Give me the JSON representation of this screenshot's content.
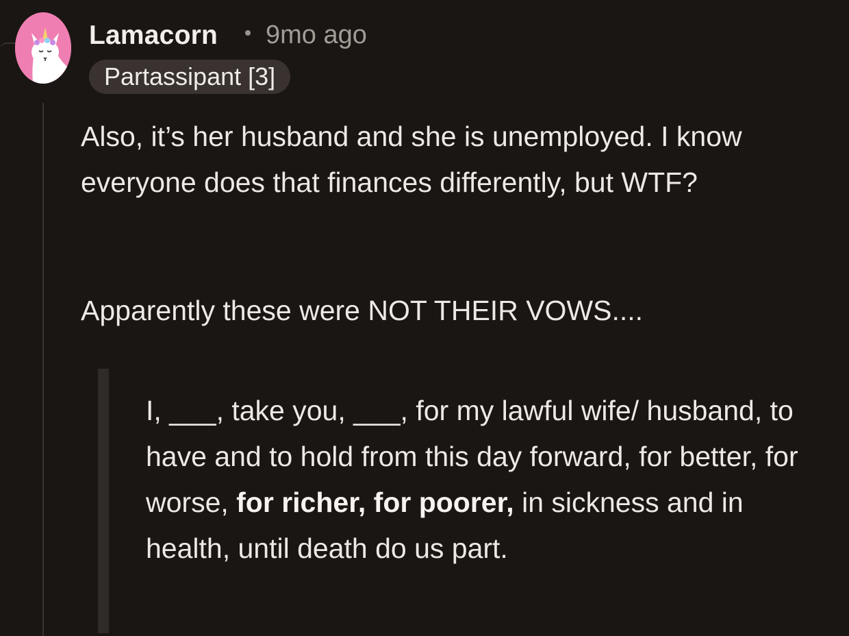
{
  "comment": {
    "author": "Lamacorn",
    "separator": "•",
    "timestamp": "9mo ago",
    "flair": "Partassipant [3]",
    "avatar_icon": "llama-unicorn-avatar-icon",
    "avatar_bg": "#ef7fb2",
    "paragraphs": [
      "Also, it’s her husband and she is unemployed. I know everyone does that finances differently, but WTF?",
      "Apparently these were NOT THEIR VOWS...."
    ],
    "quote": {
      "before": "I, ___, take you, ___, for my lawful wife/ husband, to have and to hold from this day forward, for better, for worse, ",
      "bold": "for richer, for poorer,",
      "after": " in sickness and in health, until death do us part."
    }
  },
  "colors": {
    "background": "#1a1613",
    "text": "#ece9e6",
    "muted": "#a29c97",
    "flair_bg": "#3a3230",
    "quote_bar": "#302b28"
  }
}
